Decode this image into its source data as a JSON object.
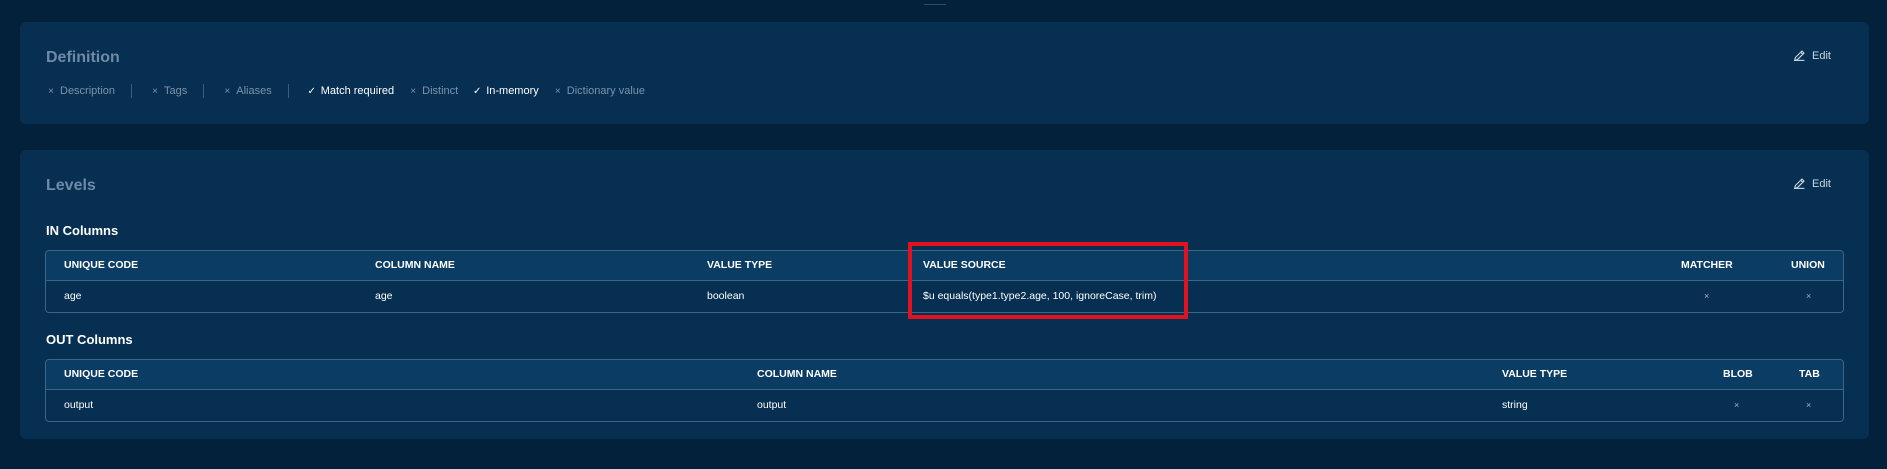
{
  "definition": {
    "title": "Definition",
    "edit_label": "Edit",
    "flags": [
      {
        "label": "Description",
        "state": "off",
        "mark": "×"
      },
      {
        "label": "Tags",
        "state": "off",
        "mark": "×"
      },
      {
        "label": "Aliases",
        "state": "off",
        "mark": "×"
      },
      {
        "label": "Match required",
        "state": "on",
        "mark": "✓"
      },
      {
        "label": "Distinct",
        "state": "off",
        "mark": "×"
      },
      {
        "label": "In-memory",
        "state": "on",
        "mark": "✓"
      },
      {
        "label": "Dictionary value",
        "state": "off",
        "mark": "×"
      }
    ]
  },
  "levels": {
    "title": "Levels",
    "edit_label": "Edit",
    "in_columns": {
      "label": "IN Columns",
      "headers": {
        "unique_code": "UNIQUE CODE",
        "column_name": "COLUMN NAME",
        "value_type": "VALUE TYPE",
        "value_source": "VALUE SOURCE",
        "matcher": "MATCHER",
        "union": "UNION"
      },
      "rows": [
        {
          "unique_code": "age",
          "column_name": "age",
          "value_type": "boolean",
          "value_source": "$u equals(type1.type2.age, 100, ignoreCase, trim)",
          "matcher": "×",
          "union": "×"
        }
      ]
    },
    "out_columns": {
      "label": "OUT Columns",
      "headers": {
        "unique_code": "UNIQUE CODE",
        "column_name": "COLUMN NAME",
        "value_type": "VALUE TYPE",
        "blob": "BLOB",
        "tab": "TAB"
      },
      "rows": [
        {
          "unique_code": "output",
          "column_name": "output",
          "value_type": "string",
          "blob": "×",
          "tab": "×"
        }
      ]
    }
  },
  "colors": {
    "background": "#03213a",
    "card": "#062f52",
    "table_header": "#0b3c63",
    "highlight": "#e0121f"
  }
}
